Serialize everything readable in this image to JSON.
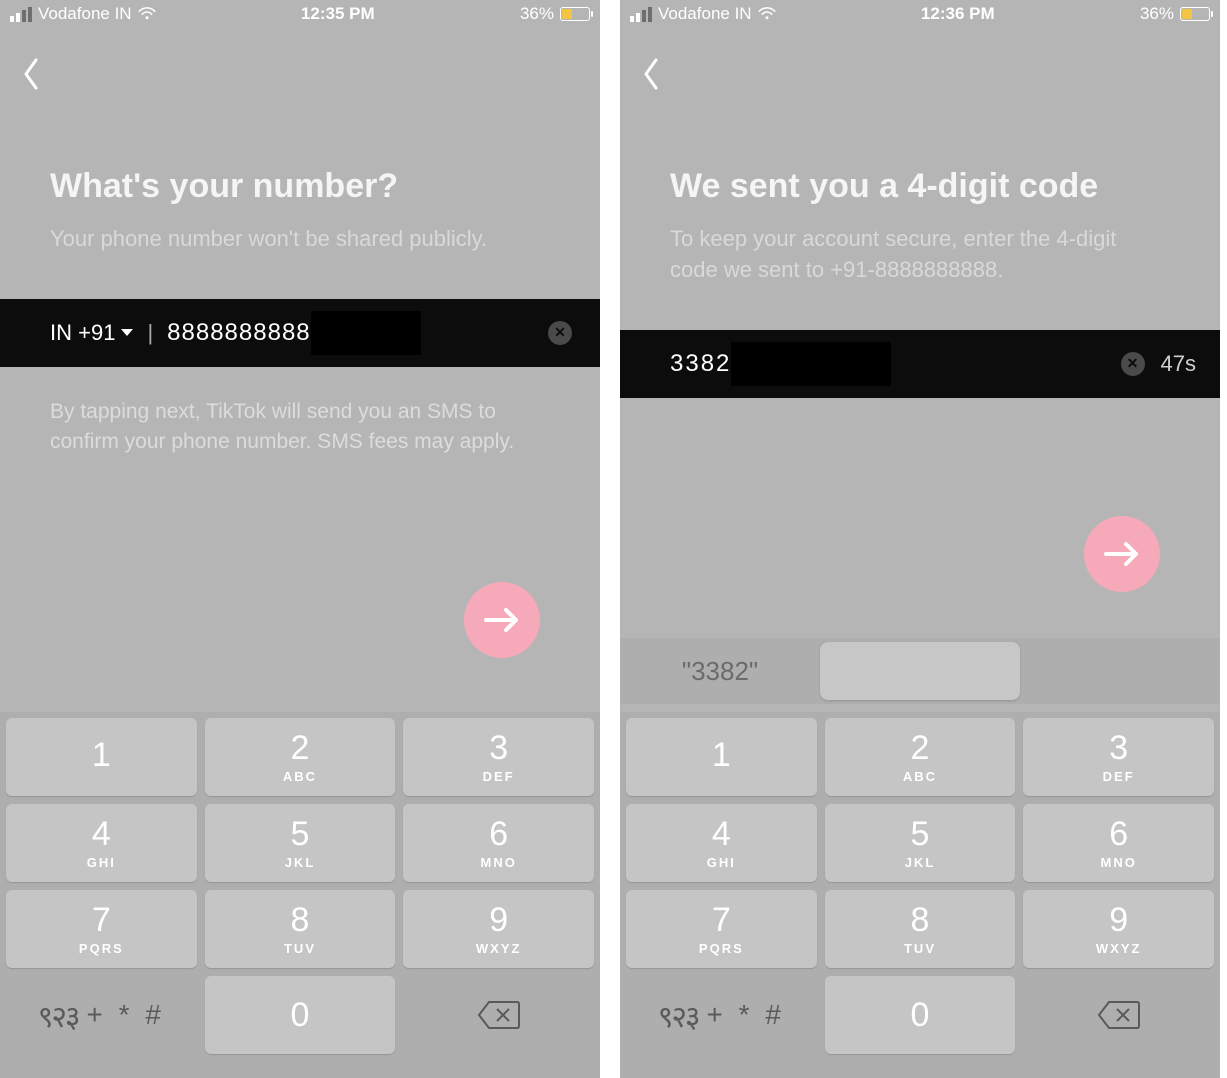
{
  "left": {
    "status": {
      "carrier": "Vodafone IN",
      "time": "12:35 PM",
      "battery": "36%"
    },
    "title": "What's your number?",
    "subtitle": "Your phone number won't be shared publicly.",
    "country_code": "IN +91",
    "phone_value": "8888888888",
    "helper": "By tapping next, TikTok will send you an SMS to confirm your phone number. SMS fees may apply."
  },
  "right": {
    "status": {
      "carrier": "Vodafone IN",
      "time": "12:36 PM",
      "battery": "36%"
    },
    "title": "We sent you a 4-digit code",
    "subtitle": "To keep your account secure, enter the 4-digit code we sent to +91-8888888888.",
    "code_value": "3382",
    "timer": "47s",
    "suggestion": "\"3382\""
  },
  "keypad": {
    "k1": {
      "n": "1",
      "l": ""
    },
    "k2": {
      "n": "2",
      "l": "ABC"
    },
    "k3": {
      "n": "3",
      "l": "DEF"
    },
    "k4": {
      "n": "4",
      "l": "GHI"
    },
    "k5": {
      "n": "5",
      "l": "JKL"
    },
    "k6": {
      "n": "6",
      "l": "MNO"
    },
    "k7": {
      "n": "7",
      "l": "PQRS"
    },
    "k8": {
      "n": "8",
      "l": "TUV"
    },
    "k9": {
      "n": "9",
      "l": "WXYZ"
    },
    "k0": {
      "n": "0",
      "l": ""
    },
    "globe": "९२३",
    "sym": "+ * #"
  }
}
